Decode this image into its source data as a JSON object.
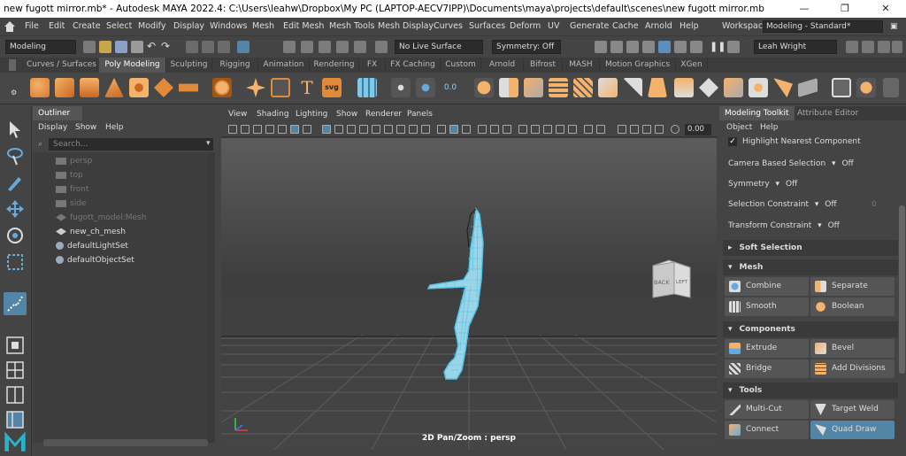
{
  "window": {
    "title": "new fugott mirror.mb* - Autodesk MAYA 2022.4: C:\\Users\\leahw\\Dropbox\\My PC (LAPTOP-AECV7IPP)\\Documents\\maya\\projects\\default\\scenes\\new fugott mirror.mb",
    "minimize": "—",
    "maximize": "❐",
    "close": "✕"
  },
  "menubar": {
    "items": [
      "File",
      "Edit",
      "Create",
      "Select",
      "Modify",
      "Display",
      "Windows",
      "Mesh",
      "Edit Mesh",
      "Mesh Tools",
      "Mesh Display",
      "Curves",
      "Surfaces",
      "Deform",
      "UV",
      "Generate",
      "Cache",
      "Arnold",
      "Help"
    ],
    "workspace_label": "Workspace:",
    "workspace_value": "Modeling - Standard*"
  },
  "statusline": {
    "mode": "Modeling",
    "live_surface": "No Live Surface",
    "symmetry": "Symmetry: Off",
    "user": "Leah Wright"
  },
  "shelf": {
    "tabs": [
      "Curves / Surfaces",
      "Poly Modeling",
      "Sculpting",
      "Rigging",
      "Animation",
      "Rendering",
      "FX",
      "FX Caching",
      "Custom",
      "Arnold",
      "Bifrost",
      "MASH",
      "Motion Graphics",
      "XGen"
    ],
    "active_tab": "Poly Modeling",
    "text_icon": "T",
    "svg_icon": "svg",
    "value_icon": "0.0"
  },
  "outliner": {
    "tab": "Outliner",
    "menu": [
      "Display",
      "Show",
      "Help"
    ],
    "search_placeholder": "Search...",
    "items": [
      {
        "label": "persp",
        "dim": true,
        "icon": "camera-icon"
      },
      {
        "label": "top",
        "dim": true,
        "icon": "camera-icon"
      },
      {
        "label": "front",
        "dim": true,
        "icon": "camera-icon"
      },
      {
        "label": "side",
        "dim": true,
        "icon": "camera-icon"
      },
      {
        "label": "fugott_model:Mesh",
        "dim": true,
        "icon": "mesh-icon"
      },
      {
        "label": "new_ch_mesh",
        "dim": false,
        "icon": "mesh-icon"
      },
      {
        "label": "defaultLightSet",
        "dim": false,
        "icon": "set-icon"
      },
      {
        "label": "defaultObjectSet",
        "dim": false,
        "icon": "set-icon"
      }
    ]
  },
  "viewport": {
    "menu": [
      "View",
      "Shading",
      "Lighting",
      "Show",
      "Renderer",
      "Panels"
    ],
    "field_value": "0.00",
    "label": "2D Pan/Zoom : persp",
    "viewcube_back": "BACK",
    "viewcube_left": "LEFT",
    "accent": "#4fc3e8"
  },
  "toolkit": {
    "tabs": [
      "Modeling Toolkit",
      "Attribute Editor"
    ],
    "menu": [
      "Object",
      "Help"
    ],
    "highlight": "Highlight Nearest Component",
    "camera_based": {
      "label": "Camera Based Selection",
      "value": "Off"
    },
    "symmetry": {
      "label": "Symmetry",
      "value": "Off"
    },
    "selection_constraint": {
      "label": "Selection Constraint",
      "value": "Off",
      "number": "0"
    },
    "transform_constraint": {
      "label": "Transform Constraint",
      "value": "Off"
    },
    "soft_selection": "Soft Selection",
    "sections": {
      "mesh": "Mesh",
      "components": "Components",
      "tools": "Tools"
    },
    "buttons": {
      "combine": "Combine",
      "separate": "Separate",
      "smooth": "Smooth",
      "boolean": "Boolean",
      "extrude": "Extrude",
      "bevel": "Bevel",
      "bridge": "Bridge",
      "add_divisions": "Add Divisions",
      "multi_cut": "Multi-Cut",
      "target_weld": "Target Weld",
      "connect": "Connect",
      "quad_draw": "Quad Draw"
    }
  }
}
